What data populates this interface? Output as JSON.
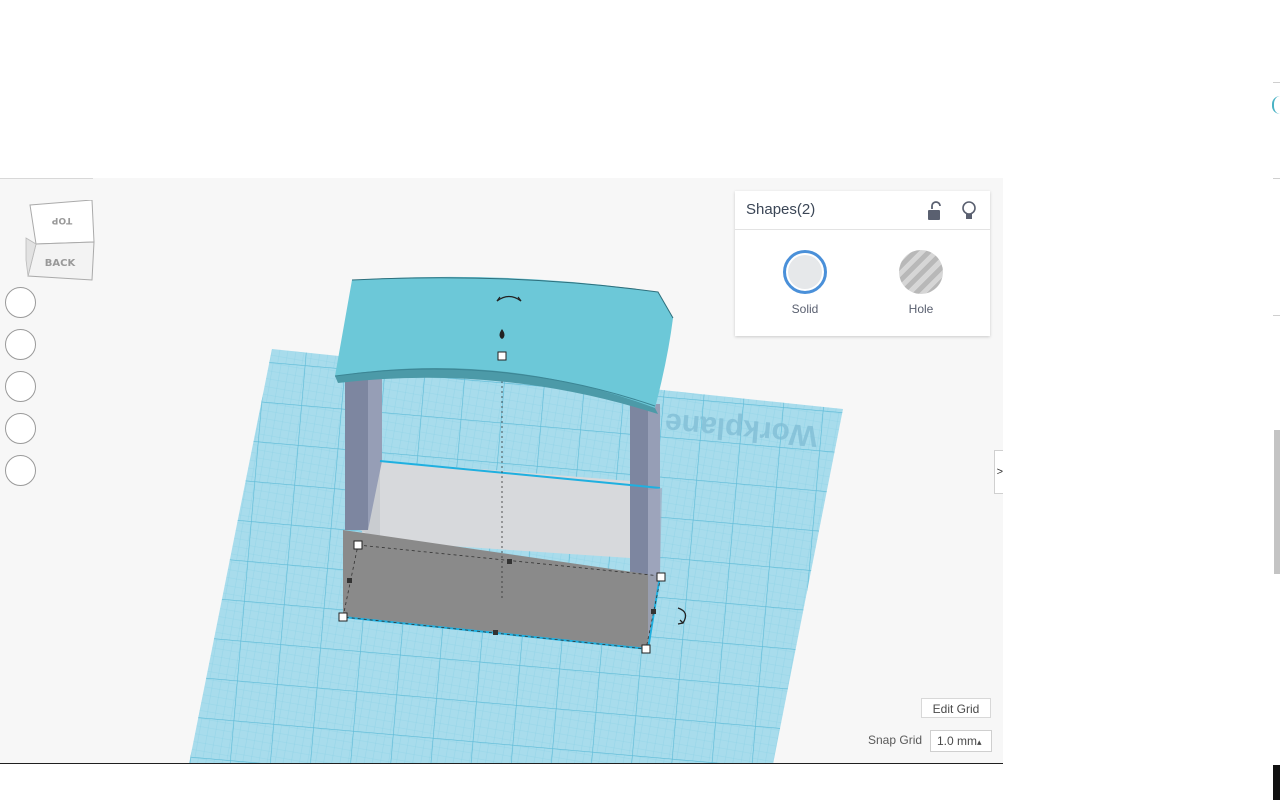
{
  "viewcube": {
    "top_label": "TOP",
    "back_label": "BACK"
  },
  "workplane": {
    "watermark": "Workplane"
  },
  "nav_buttons": [
    "home-view",
    "fit-view",
    "zoom-in",
    "zoom-out",
    "perspective-toggle"
  ],
  "shapes_panel": {
    "title": "Shapes(2)",
    "lock_icon": "unlock-icon",
    "light_icon": "lightbulb-icon",
    "solid_label": "Solid",
    "hole_label": "Hole"
  },
  "grid_controls": {
    "edit_grid_label": "Edit Grid",
    "snap_grid_label": "Snap Grid",
    "snap_value": "1.0 mm",
    "snap_arrow": "▴"
  },
  "colors": {
    "workplane": "#a8dcec",
    "grid_line": "#6cc6e0",
    "roof": "#6cc8d8",
    "pillar": "#8a92aa",
    "box_front": "#8a8a8a",
    "box_inner": "#d7d9dc",
    "selection": "#1fb0e0",
    "solid_ring": "#4a90d9"
  }
}
